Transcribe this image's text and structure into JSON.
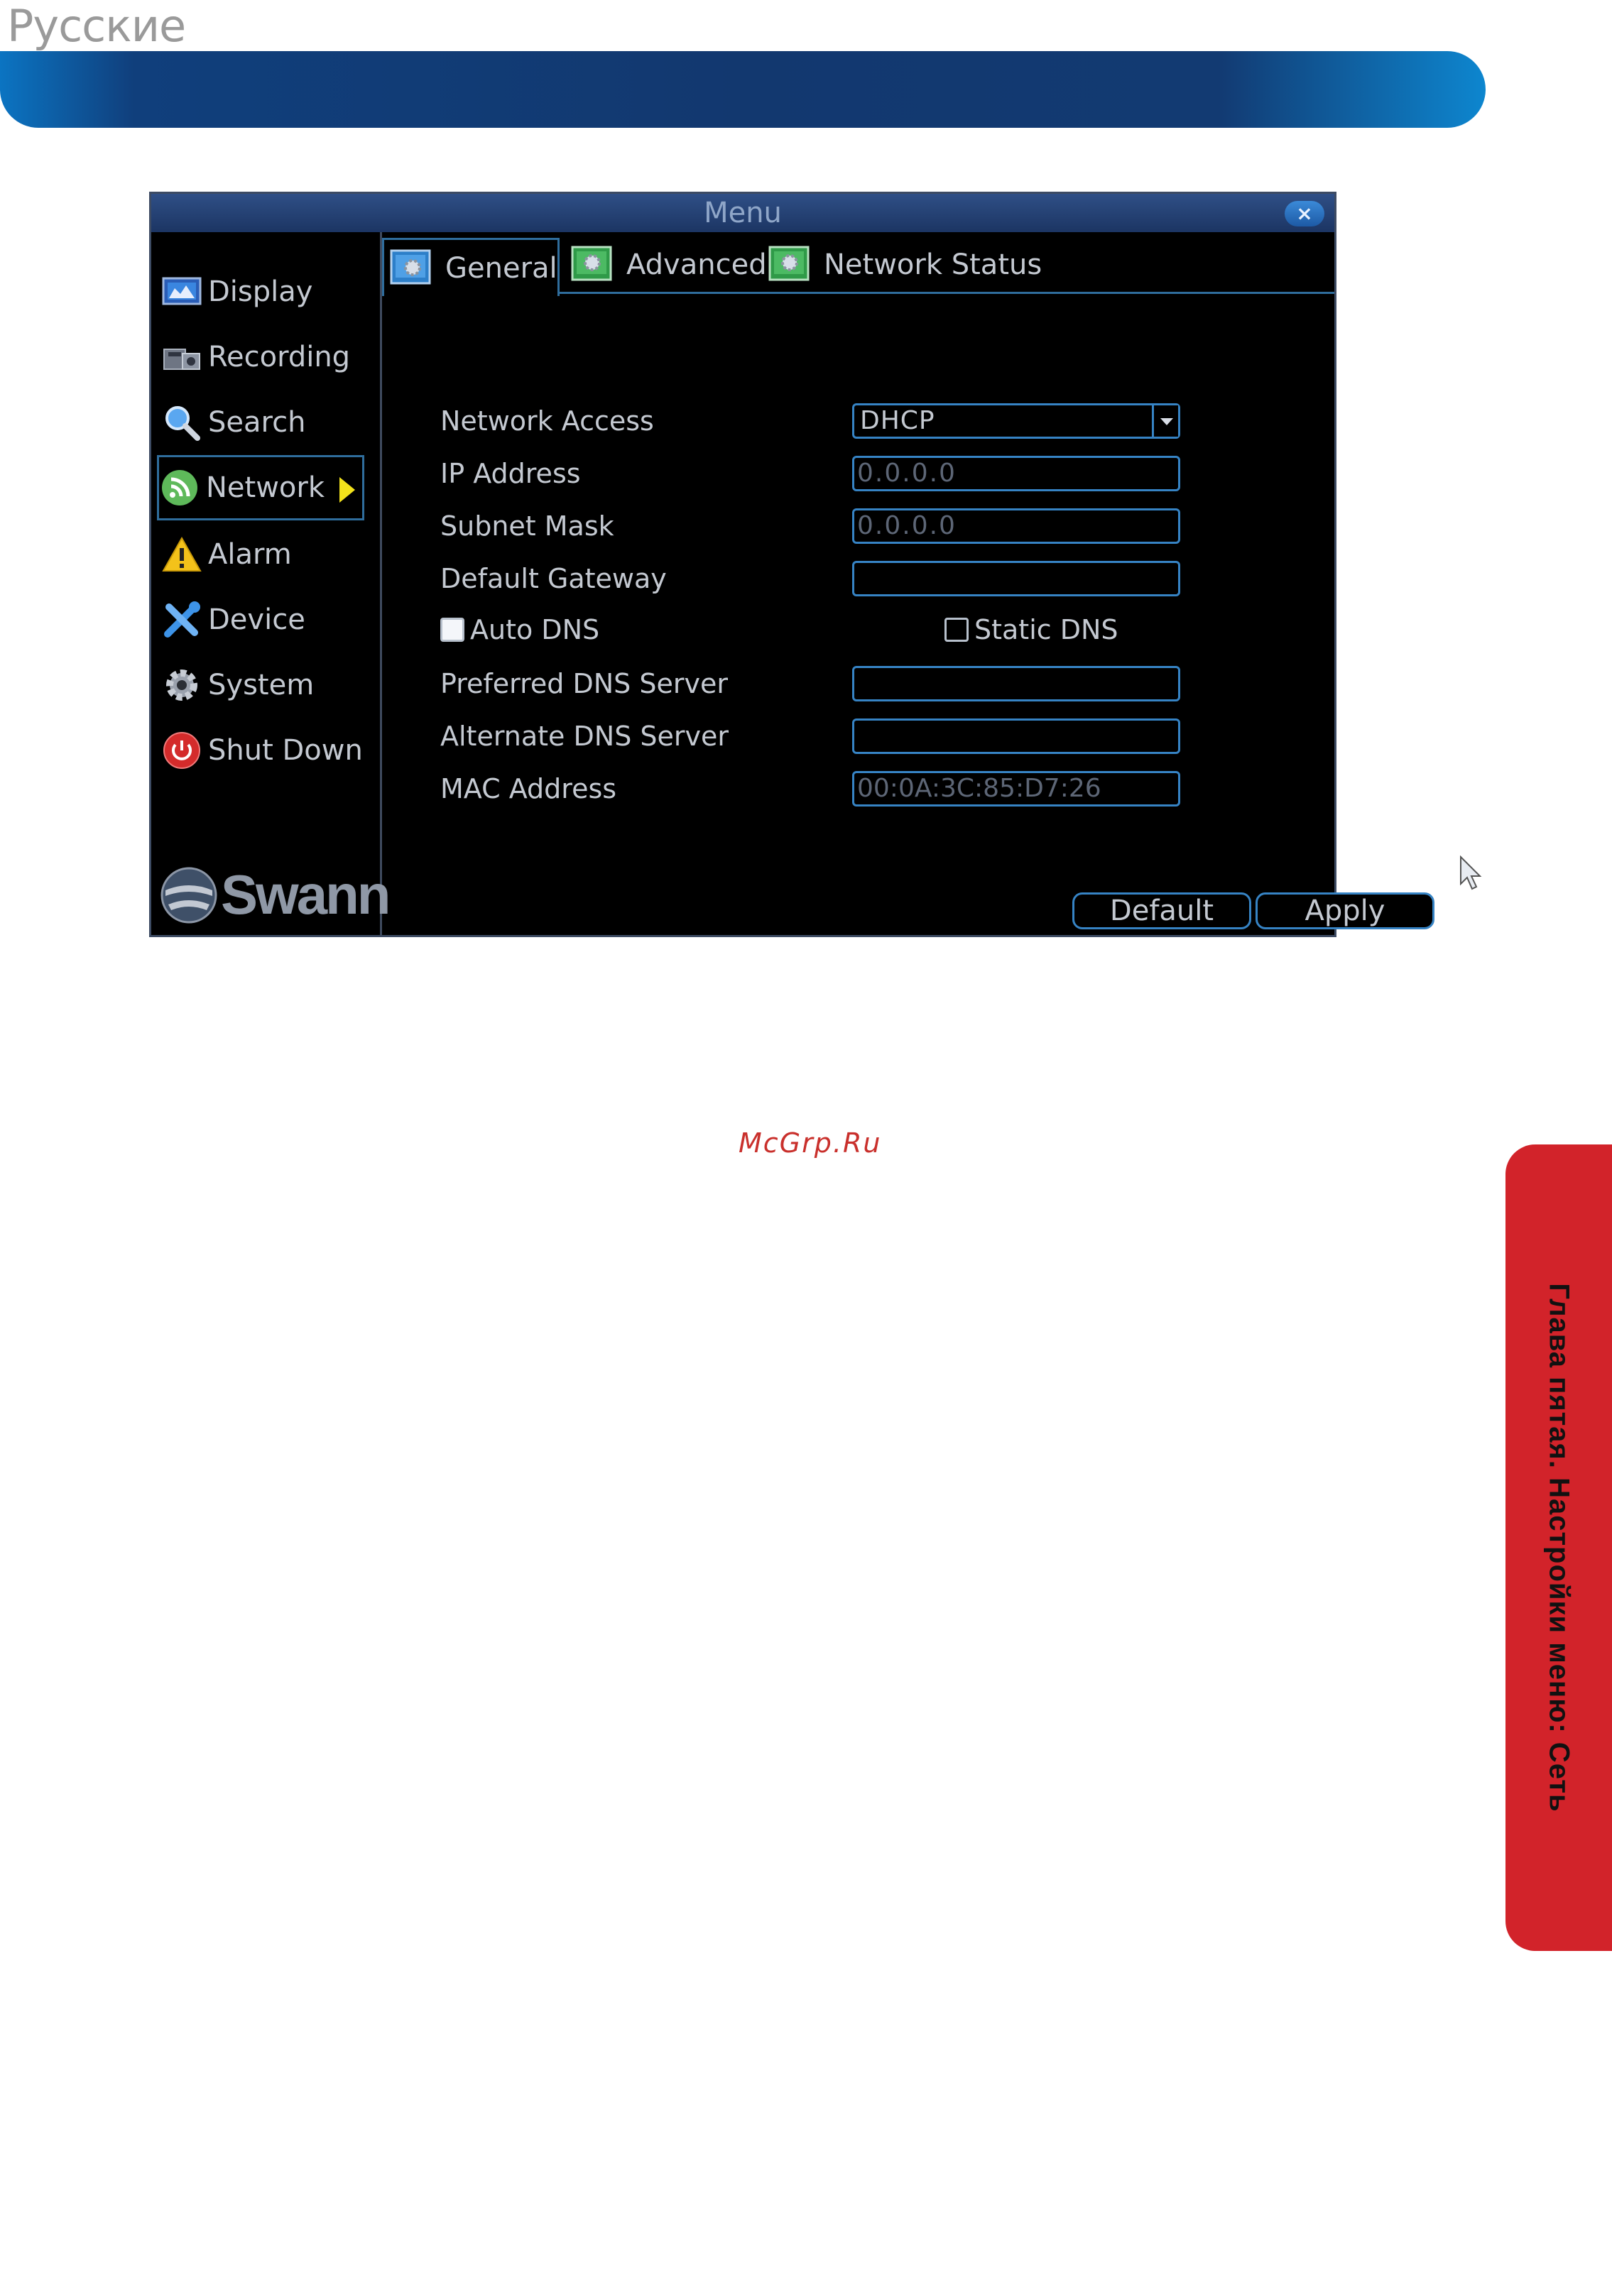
{
  "page": {
    "language_heading": "Русские",
    "watermark": "McGrp.Ru",
    "side_tab_text": "Глава пятая. Настройки меню: Сеть"
  },
  "window": {
    "title": "Menu",
    "close_label": "×"
  },
  "sidebar": {
    "items": [
      {
        "label": "Display",
        "icon": "display-icon"
      },
      {
        "label": "Recording",
        "icon": "recording-icon"
      },
      {
        "label": "Search",
        "icon": "search-icon"
      },
      {
        "label": "Network",
        "icon": "network-icon",
        "active": true
      },
      {
        "label": "Alarm",
        "icon": "alarm-icon"
      },
      {
        "label": "Device",
        "icon": "device-icon"
      },
      {
        "label": "System",
        "icon": "system-icon"
      },
      {
        "label": "Shut Down",
        "icon": "shutdown-icon"
      }
    ],
    "logo": "Swann"
  },
  "tabs": [
    {
      "label": "General",
      "active": true
    },
    {
      "label": "Advanced"
    },
    {
      "label": "Network Status"
    }
  ],
  "form": {
    "network_access": {
      "label": "Network Access",
      "value": "DHCP"
    },
    "ip_address": {
      "label": "IP Address",
      "value": "0.0.0.0"
    },
    "subnet_mask": {
      "label": "Subnet Mask",
      "value": "0.0.0.0"
    },
    "default_gateway": {
      "label": "Default Gateway",
      "value": ""
    },
    "auto_dns": {
      "label": "Auto DNS",
      "checked": true
    },
    "static_dns": {
      "label": "Static DNS",
      "checked": false
    },
    "preferred_dns": {
      "label": "Preferred DNS Server",
      "value": ""
    },
    "alternate_dns": {
      "label": "Alternate DNS Server",
      "value": ""
    },
    "mac_address": {
      "label": "MAC Address",
      "value": "00:0A:3C:85:D7:26"
    }
  },
  "buttons": {
    "default_label": "Default",
    "apply_label": "Apply"
  },
  "colors": {
    "banner": "#12386f",
    "side_tab": "#d2232a",
    "field_border": "#3683c4",
    "window_bg": "#000000"
  }
}
